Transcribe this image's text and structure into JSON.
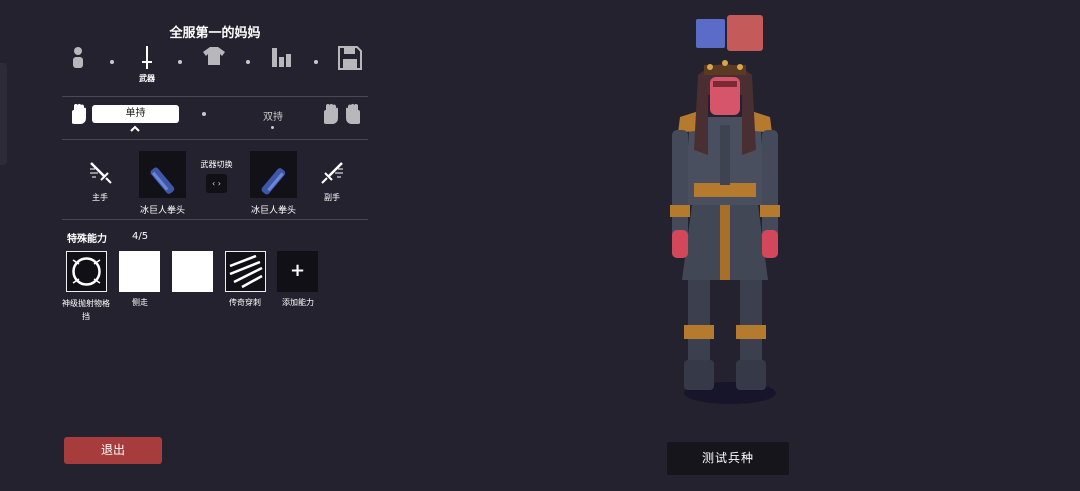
{
  "unit_title": "全服第一的妈妈",
  "tabs": {
    "weapon_label": "武器"
  },
  "grip": {
    "single": "单持",
    "dual": "双持"
  },
  "weapons": {
    "main_hand_label": "主手",
    "off_hand_label": "副手",
    "switch_label": "武器切换",
    "switch_icon": "‹ ›",
    "left_weapon_name": "冰巨人拳头",
    "right_weapon_name": "冰巨人拳头"
  },
  "abilities": {
    "header": "特殊能力",
    "count": "4/5",
    "items": [
      {
        "label": "神级抛射物格挡"
      },
      {
        "label": "侧走"
      },
      {
        "label": ""
      },
      {
        "label": "传奇穿刺"
      },
      {
        "label": "添加能力",
        "icon": "+"
      }
    ]
  },
  "buttons": {
    "exit": "退出",
    "test_unit": "测试兵种"
  },
  "colors": {
    "team_blue": "#5a6bc8",
    "team_red": "#c45a5a",
    "exit_red": "#a73c3c",
    "background": "#24222e"
  }
}
